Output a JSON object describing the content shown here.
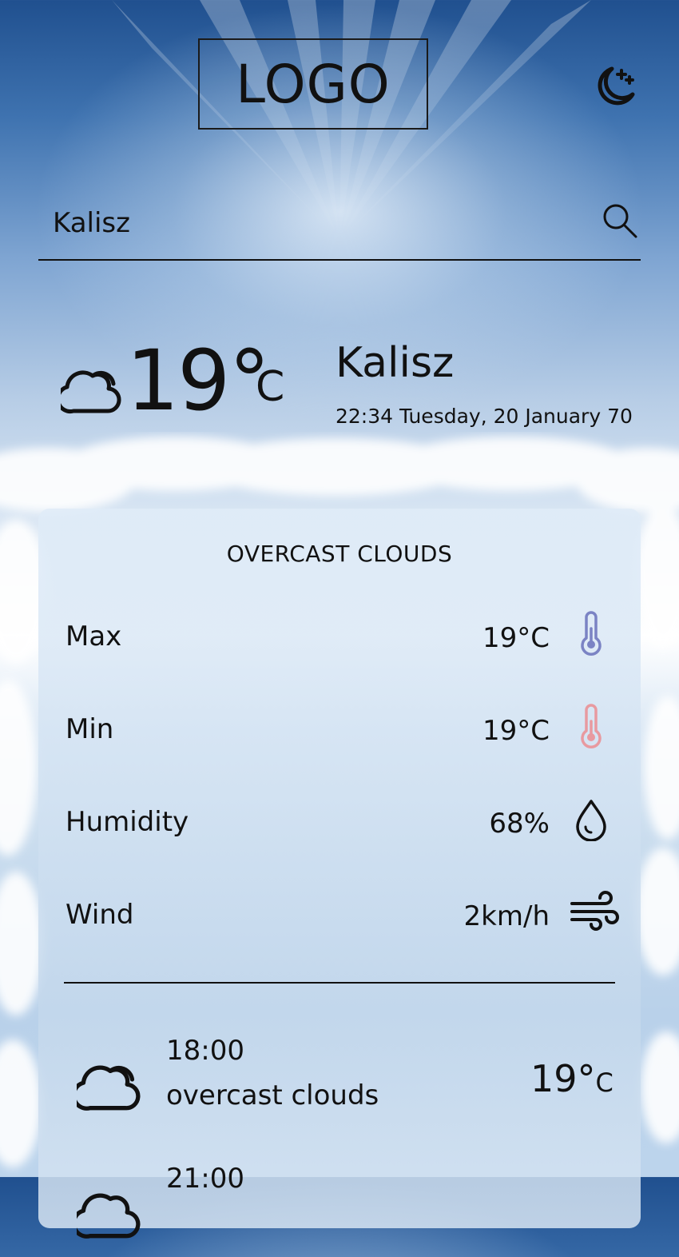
{
  "header": {
    "logo_text": "LOGO",
    "theme_icon": "moon-stars-icon"
  },
  "search": {
    "value": "Kalisz",
    "icon": "search-icon"
  },
  "current": {
    "icon": "cloud-icon",
    "temperature": "19°",
    "unit": "C",
    "city": "Kalisz",
    "datetime": "22:34 Tuesday, 20 January 70"
  },
  "details": {
    "title": "OVERCAST CLOUDS",
    "rows": [
      {
        "label": "Max",
        "value": "19°C",
        "icon": "thermometer-cold-icon",
        "color": "#7b83c4"
      },
      {
        "label": "Min",
        "value": "19°C",
        "icon": "thermometer-hot-icon",
        "color": "#e89aa0"
      },
      {
        "label": "Humidity",
        "value": "68%",
        "icon": "water-drop-icon",
        "color": "#111111"
      },
      {
        "label": "Wind",
        "value": "2km/h",
        "icon": "wind-icon",
        "color": "#111111"
      }
    ]
  },
  "forecast": [
    {
      "time": "18:00",
      "description": "overcast clouds",
      "temperature": "19°",
      "unit": "C",
      "icon": "cloud-icon"
    },
    {
      "time": "21:00",
      "description": "",
      "temperature": "",
      "unit": "",
      "icon": "cloud-icon"
    }
  ]
}
